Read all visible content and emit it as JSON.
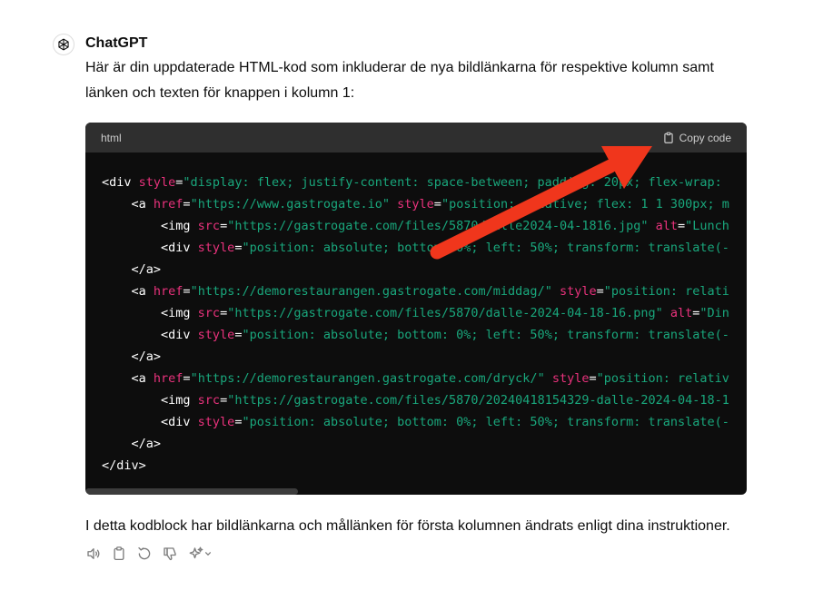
{
  "message": {
    "sender": "ChatGPT",
    "intro": "Här är din uppdaterade HTML-kod som inkluderar de nya bildlänkarna för respektive kolumn samt länken och texten för knappen i kolumn 1:",
    "outro": "I detta kodblock har bildlänkarna och mållänken för första kolumnen ändrats enligt dina instruktioner."
  },
  "code_block": {
    "language": "html",
    "copy_label": "Copy code",
    "lines": [
      [
        {
          "t": "tag",
          "v": "<div "
        },
        {
          "t": "attr",
          "v": "style"
        },
        {
          "t": "eq",
          "v": "="
        },
        {
          "t": "str",
          "v": "\"display: flex; justify-content: space-between; padding: 20px; flex-wrap: "
        }
      ],
      [
        {
          "t": "tag",
          "v": "    <a "
        },
        {
          "t": "attr",
          "v": "href"
        },
        {
          "t": "eq",
          "v": "="
        },
        {
          "t": "str",
          "v": "\"https://www.gastrogate.io\""
        },
        {
          "t": "tag",
          "v": " "
        },
        {
          "t": "attr",
          "v": "style"
        },
        {
          "t": "eq",
          "v": "="
        },
        {
          "t": "str",
          "v": "\"position: relative; flex: 1 1 300px; m"
        }
      ],
      [
        {
          "t": "tag",
          "v": "        <img "
        },
        {
          "t": "attr",
          "v": "src"
        },
        {
          "t": "eq",
          "v": "="
        },
        {
          "t": "str",
          "v": "\"https://gastrogate.com/files/5870/dalle2024-04-1816.jpg\""
        },
        {
          "t": "tag",
          "v": " "
        },
        {
          "t": "attr",
          "v": "alt"
        },
        {
          "t": "eq",
          "v": "="
        },
        {
          "t": "str",
          "v": "\"Lunch"
        }
      ],
      [
        {
          "t": "tag",
          "v": "        <div "
        },
        {
          "t": "attr",
          "v": "style"
        },
        {
          "t": "eq",
          "v": "="
        },
        {
          "t": "str",
          "v": "\"position: absolute; bottom: 0%; left: 50%; transform: translate(-"
        }
      ],
      [
        {
          "t": "tag",
          "v": "    </a>"
        }
      ],
      [
        {
          "t": "tag",
          "v": "    <a "
        },
        {
          "t": "attr",
          "v": "href"
        },
        {
          "t": "eq",
          "v": "="
        },
        {
          "t": "str",
          "v": "\"https://demorestaurangen.gastrogate.com/middag/\""
        },
        {
          "t": "tag",
          "v": " "
        },
        {
          "t": "attr",
          "v": "style"
        },
        {
          "t": "eq",
          "v": "="
        },
        {
          "t": "str",
          "v": "\"position: relati"
        }
      ],
      [
        {
          "t": "tag",
          "v": "        <img "
        },
        {
          "t": "attr",
          "v": "src"
        },
        {
          "t": "eq",
          "v": "="
        },
        {
          "t": "str",
          "v": "\"https://gastrogate.com/files/5870/dalle-2024-04-18-16.png\""
        },
        {
          "t": "tag",
          "v": " "
        },
        {
          "t": "attr",
          "v": "alt"
        },
        {
          "t": "eq",
          "v": "="
        },
        {
          "t": "str",
          "v": "\"Din"
        }
      ],
      [
        {
          "t": "tag",
          "v": "        <div "
        },
        {
          "t": "attr",
          "v": "style"
        },
        {
          "t": "eq",
          "v": "="
        },
        {
          "t": "str",
          "v": "\"position: absolute; bottom: 0%; left: 50%; transform: translate(-"
        }
      ],
      [
        {
          "t": "tag",
          "v": "    </a>"
        }
      ],
      [
        {
          "t": "tag",
          "v": "    <a "
        },
        {
          "t": "attr",
          "v": "href"
        },
        {
          "t": "eq",
          "v": "="
        },
        {
          "t": "str",
          "v": "\"https://demorestaurangen.gastrogate.com/dryck/\""
        },
        {
          "t": "tag",
          "v": " "
        },
        {
          "t": "attr",
          "v": "style"
        },
        {
          "t": "eq",
          "v": "="
        },
        {
          "t": "str",
          "v": "\"position: relativ"
        }
      ],
      [
        {
          "t": "tag",
          "v": "        <img "
        },
        {
          "t": "attr",
          "v": "src"
        },
        {
          "t": "eq",
          "v": "="
        },
        {
          "t": "str",
          "v": "\"https://gastrogate.com/files/5870/20240418154329-dalle-2024-04-18-1"
        }
      ],
      [
        {
          "t": "tag",
          "v": "        <div "
        },
        {
          "t": "attr",
          "v": "style"
        },
        {
          "t": "eq",
          "v": "="
        },
        {
          "t": "str",
          "v": "\"position: absolute; bottom: 0%; left: 50%; transform: translate(-"
        }
      ],
      [
        {
          "t": "tag",
          "v": "    </a>"
        }
      ],
      [
        {
          "t": "tag",
          "v": "</div>"
        }
      ]
    ]
  },
  "actions": [
    {
      "icon": "read-aloud-icon"
    },
    {
      "icon": "copy-icon"
    },
    {
      "icon": "regenerate-icon"
    },
    {
      "icon": "thumbs-down-icon"
    },
    {
      "icon": "sparkle-model-icon"
    }
  ],
  "colors": {
    "code_bg": "#0d0d0d",
    "code_header_bg": "#2f2f2f",
    "attr": "#e9327c",
    "string": "#19a77c",
    "annotation_arrow": "#f0361c"
  }
}
